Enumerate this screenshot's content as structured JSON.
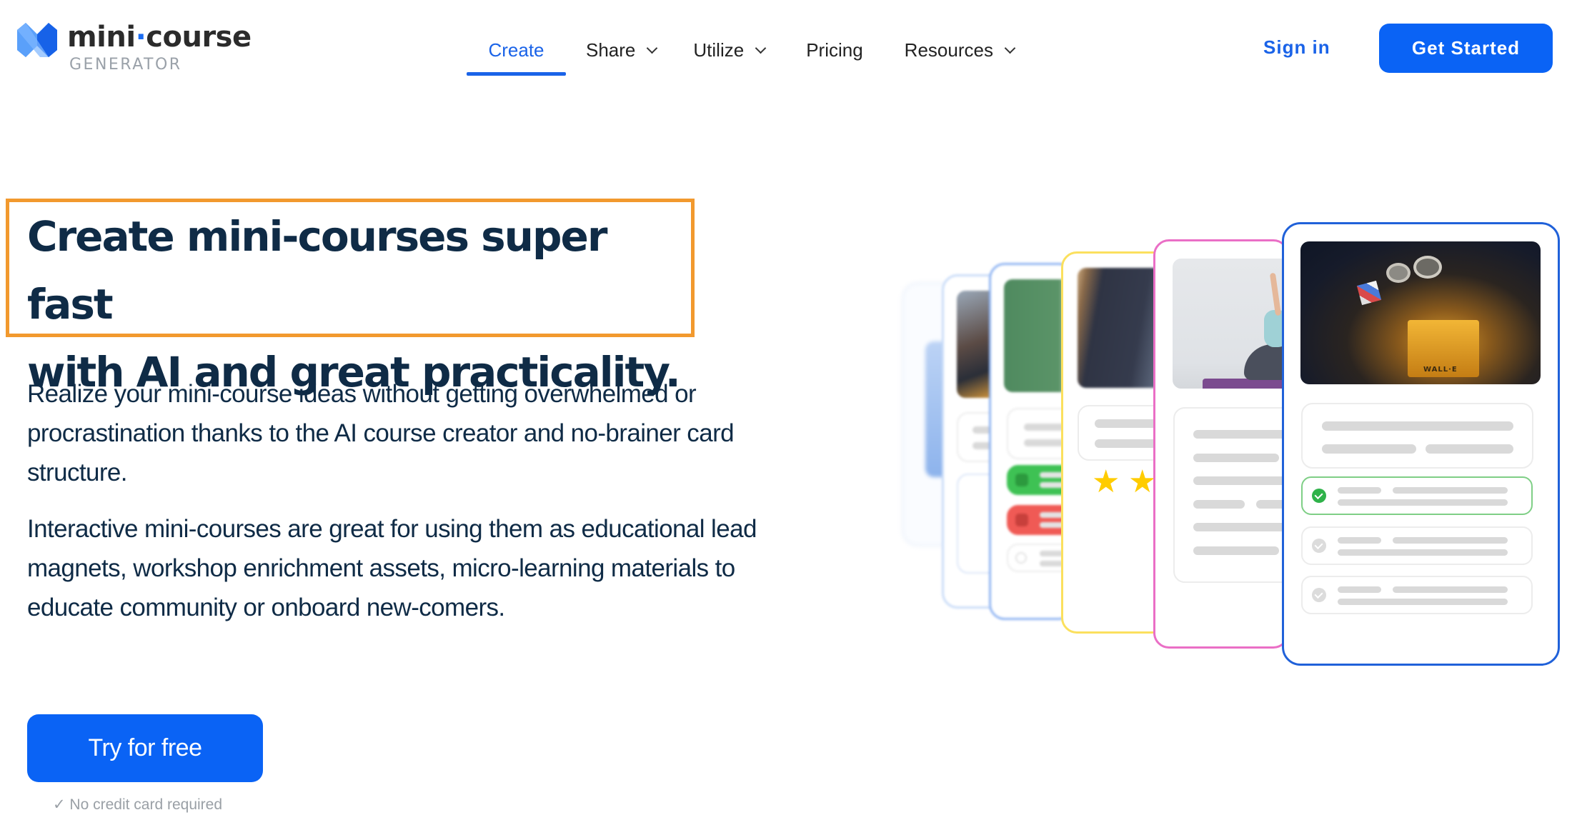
{
  "brand": {
    "name_part1": "mini",
    "name_dot": "·",
    "name_part2": "course",
    "subtitle": "GENERATOR",
    "icon": "mini-course-logo-icon",
    "color": "#1a6cf2"
  },
  "nav": {
    "items": [
      {
        "label": "Create",
        "active": true,
        "has_dropdown": false
      },
      {
        "label": "Share",
        "active": false,
        "has_dropdown": true
      },
      {
        "label": "Utilize",
        "active": false,
        "has_dropdown": true
      },
      {
        "label": "Pricing",
        "active": false,
        "has_dropdown": false
      },
      {
        "label": "Resources",
        "active": false,
        "has_dropdown": true
      }
    ],
    "sign_in": "Sign in",
    "get_started": "Get Started"
  },
  "hero": {
    "headline_line1": "Create mini-courses super fast",
    "headline_line2": "with AI and great practicality.",
    "paragraph1": "Realize your mini-course ideas without getting overwhelmed or procrastination thanks to the AI course creator and no-brainer card structure.",
    "paragraph2": "Interactive mini-courses are great for using them as educational lead magnets, workshop enrichment assets, micro-learning materials to educate community or onboard new-comers.",
    "cta_label": "Try for free",
    "cta_note_icon": "checkmark",
    "cta_note": "✓ No credit card required",
    "highlight_color": "#f2992e"
  },
  "illustration": {
    "cards": [
      {
        "name": "card-1",
        "border_color": "#eef3fb",
        "image": "blurred-photo"
      },
      {
        "name": "card-2",
        "border_color": "#c9dcf8",
        "image": "students-at-laptop-photo"
      },
      {
        "name": "card-3",
        "border_color": "#8fb4f2",
        "image": "teacher-at-chalkboard-photo",
        "answers": [
          "correct",
          "incorrect",
          "neutral"
        ]
      },
      {
        "name": "card-4",
        "border_color": "#fbe05e",
        "image": "person-photo",
        "stars": "★"
      },
      {
        "name": "card-5",
        "border_color": "#ea6fc6",
        "image": "yoga-pose-photo"
      },
      {
        "name": "card-6",
        "border_color": "#2061d9",
        "image": "wall-e-robot-photo",
        "image_caption": "WALL·E",
        "quiz_options": [
          {
            "state": "selected-correct"
          },
          {
            "state": "unselected"
          },
          {
            "state": "unselected"
          }
        ]
      }
    ],
    "colors": {
      "correct": "#2fb24a",
      "incorrect": "#f05a55",
      "star": "#ffcc00",
      "skeleton": "#d9d9d9"
    }
  },
  "colors": {
    "primary": "#0a63f5",
    "text_dark": "#0f2b46",
    "muted": "#9aa0a6"
  }
}
